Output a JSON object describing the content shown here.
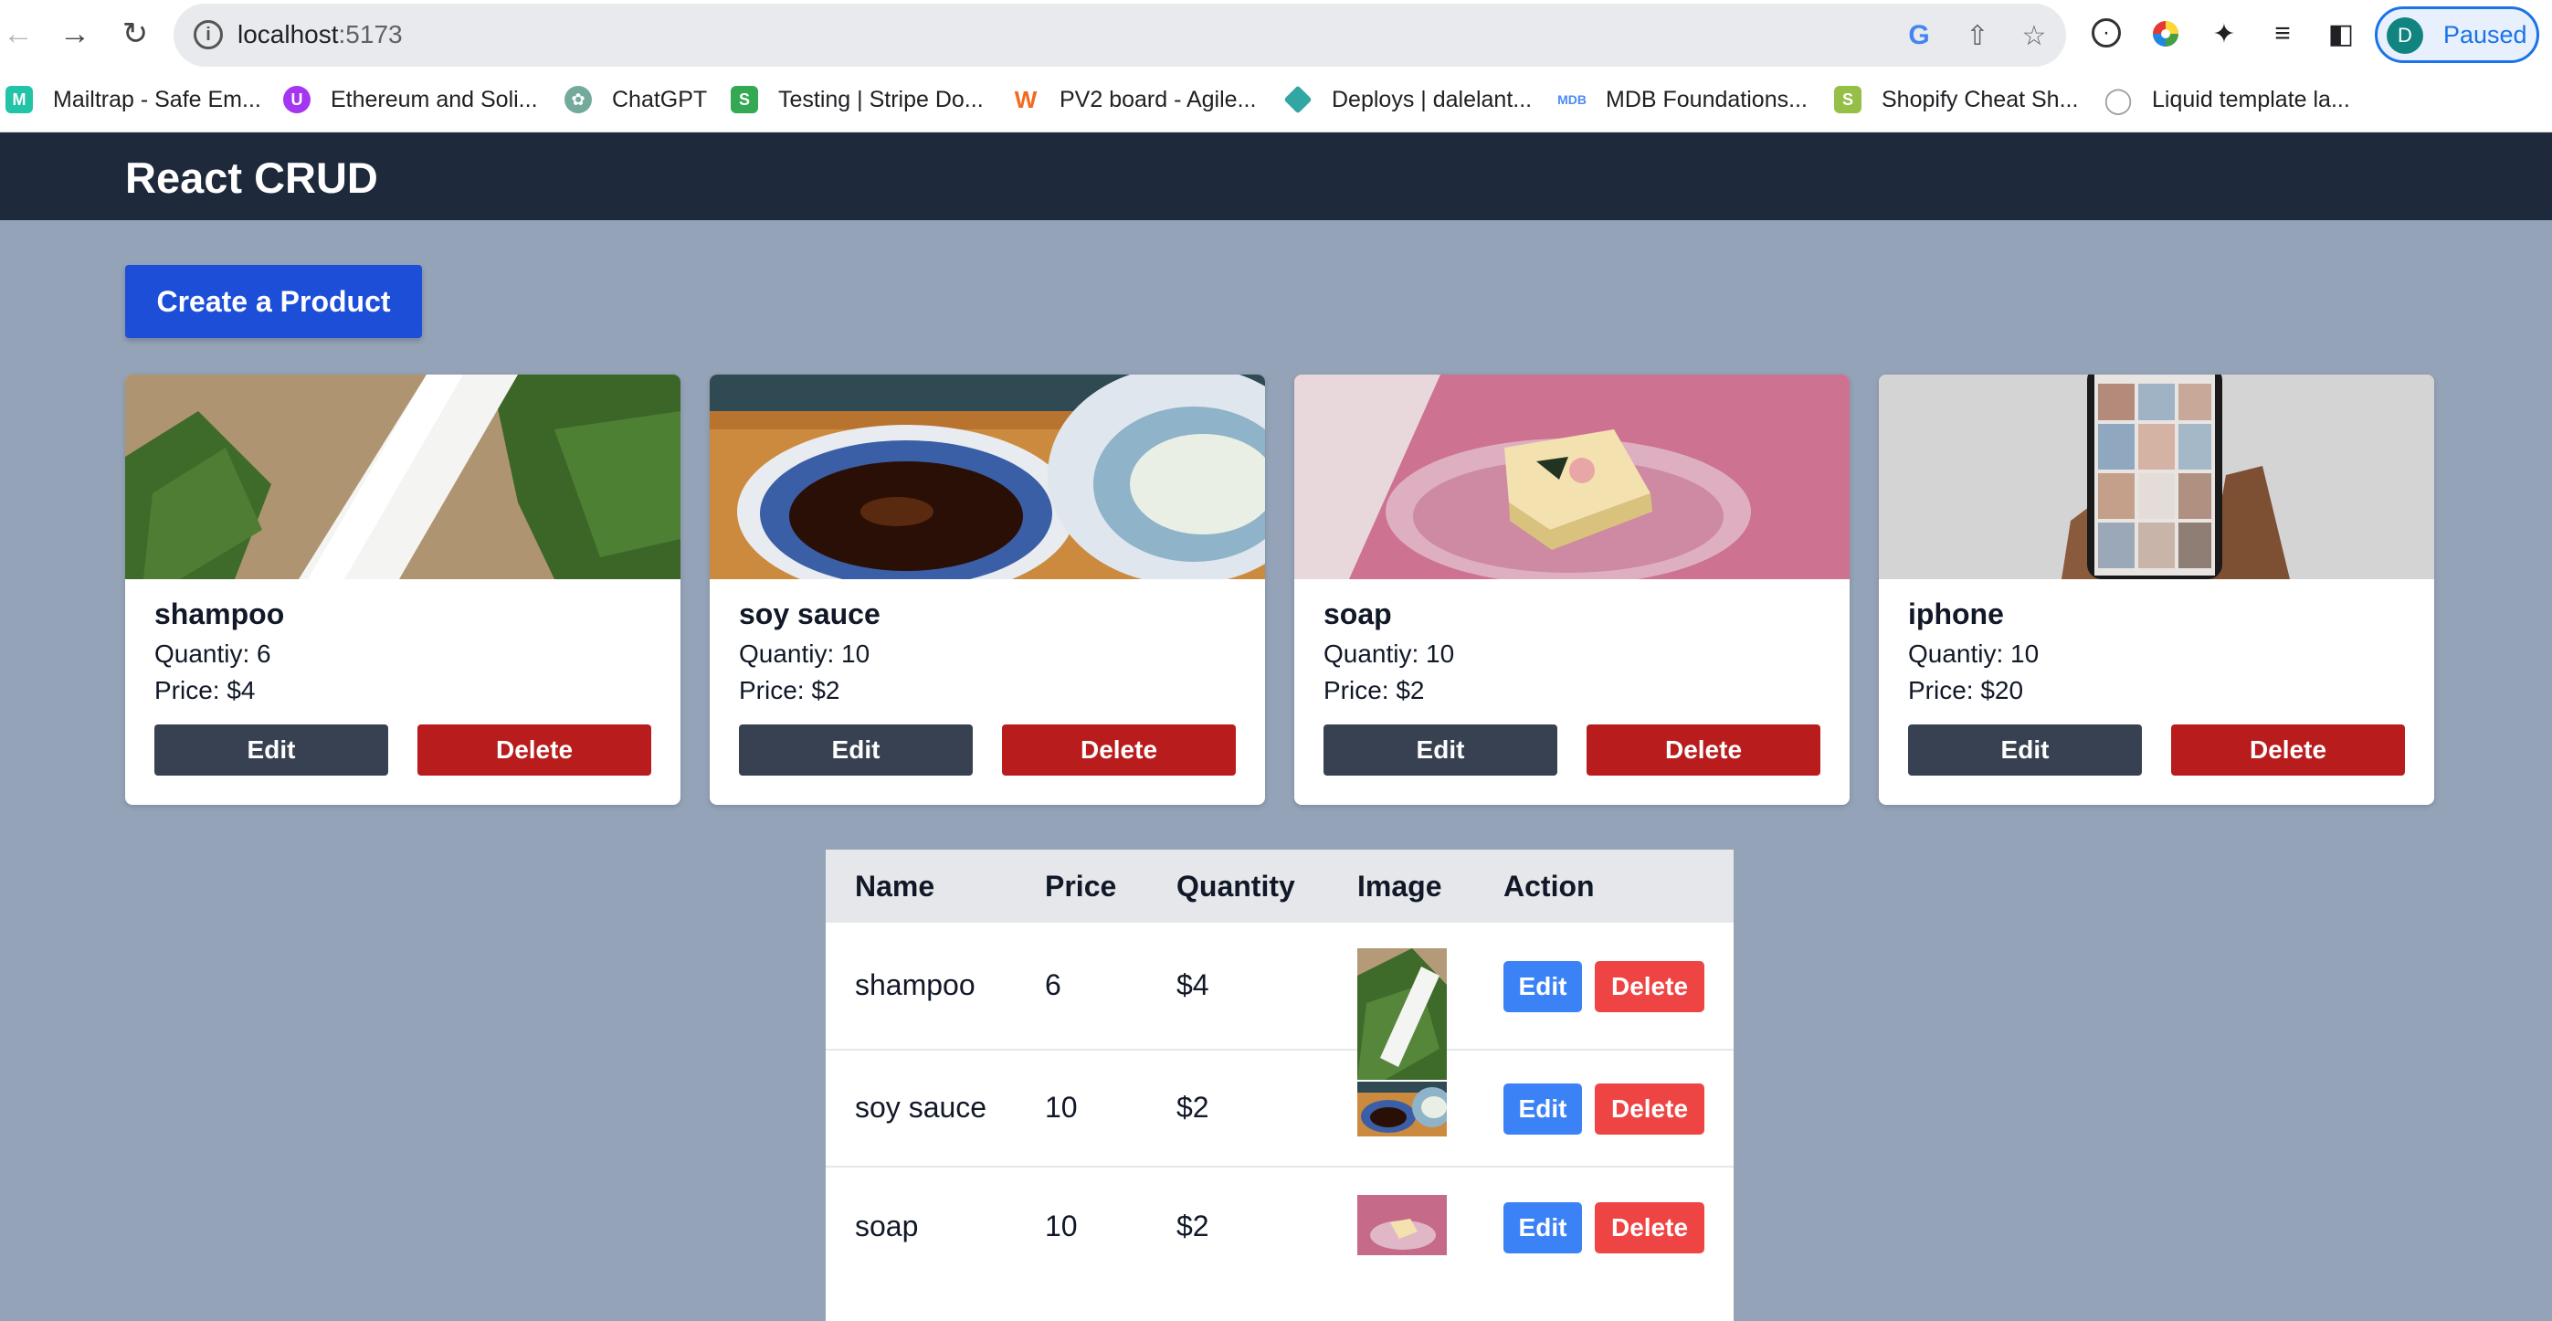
{
  "browser": {
    "url_host": "localhost",
    "url_port": ":5173",
    "profile_initial": "D",
    "profile_status": "Paused"
  },
  "bookmarks": [
    {
      "label": "Mailtrap - Safe Em...",
      "icon": "mailtrap-icon",
      "color": "#22c3a6"
    },
    {
      "label": "Ethereum and Soli...",
      "icon": "udemy-icon",
      "color": "#a435f0"
    },
    {
      "label": "ChatGPT",
      "icon": "chatgpt-icon",
      "color": "#74aa9c"
    },
    {
      "label": "Testing | Stripe Do...",
      "icon": "stripe-icon",
      "color": "#34a853"
    },
    {
      "label": "PV2 board - Agile...",
      "icon": "wrike-icon",
      "color": "#f26a21"
    },
    {
      "label": "Deploys | dalelant...",
      "icon": "netlify-icon",
      "color": "#32a6a3"
    },
    {
      "label": "MDB Foundations...",
      "icon": "mongodb-icon",
      "color": "#4b8bf5"
    },
    {
      "label": "Shopify Cheat Sh...",
      "icon": "shopify-icon",
      "color": "#95bf47"
    },
    {
      "label": "Liquid template la...",
      "icon": "droplet-icon",
      "color": "#9aa0a6"
    }
  ],
  "app": {
    "title": "React CRUD",
    "create_label": "Create a Product"
  },
  "products": [
    {
      "name": "shampoo",
      "quantity": "Quantiy: 6",
      "price": "Price: $4",
      "edit": "Edit",
      "delete": "Delete"
    },
    {
      "name": "soy sauce",
      "quantity": "Quantiy: 10",
      "price": "Price: $2",
      "edit": "Edit",
      "delete": "Delete"
    },
    {
      "name": "soap",
      "quantity": "Quantiy: 10",
      "price": "Price: $2",
      "edit": "Edit",
      "delete": "Delete"
    },
    {
      "name": "iphone",
      "quantity": "Quantiy: 10",
      "price": "Price: $20",
      "edit": "Edit",
      "delete": "Delete"
    }
  ],
  "table": {
    "headers": [
      "Name",
      "Price",
      "Quantity",
      "Image",
      "Action"
    ],
    "rows": [
      {
        "name": "shampoo",
        "price": "6",
        "quantity": "$4",
        "edit": "Edit",
        "delete": "Delete"
      },
      {
        "name": "soy sauce",
        "price": "10",
        "quantity": "$2",
        "edit": "Edit",
        "delete": "Delete"
      },
      {
        "name": "soap",
        "price": "10",
        "quantity": "$2",
        "edit": "Edit",
        "delete": "Delete"
      }
    ]
  }
}
